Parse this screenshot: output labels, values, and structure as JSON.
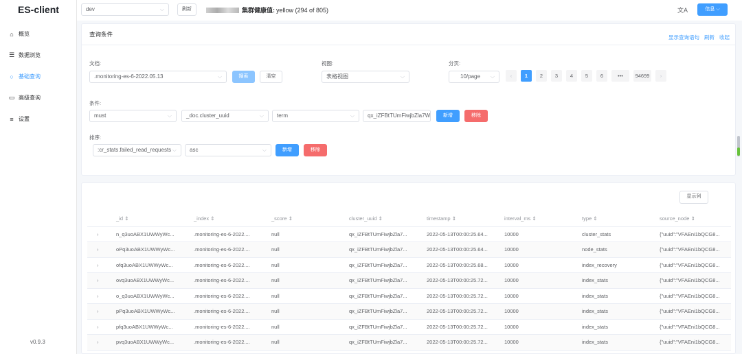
{
  "app": {
    "logo": "ES-client",
    "version": "v0.9.3"
  },
  "sidebar": {
    "items": [
      {
        "label": "概览",
        "icon": "home-icon",
        "active": false
      },
      {
        "label": "数据浏览",
        "icon": "database-icon",
        "active": false
      },
      {
        "label": "基础查询",
        "icon": "search-icon",
        "active": true
      },
      {
        "label": "高级查询",
        "icon": "monitor-icon",
        "active": false
      },
      {
        "label": "设置",
        "icon": "sliders-icon",
        "active": false
      }
    ]
  },
  "header": {
    "cluster_select": "dev",
    "refresh_label": "刷新",
    "health_prefix": "集群健康值:",
    "health_value": "yellow (294 of 805)",
    "lang_icon": "文A",
    "info_label": "信息"
  },
  "query": {
    "title": "查询条件",
    "links": [
      "显示查询语句",
      "刷新",
      "收起"
    ],
    "doc_label": "文档:",
    "doc_value": ".monitoring-es-6-2022.05.13",
    "search_label": "搜索",
    "clear_label": "清空",
    "view_label": "视图:",
    "view_value": "表格视图",
    "page_label": "分页:",
    "page_size": "10/page",
    "pages": [
      "1",
      "2",
      "3",
      "4",
      "5",
      "6",
      "•••",
      "94699"
    ],
    "cond_label": "条件:",
    "cond_bool": "must",
    "cond_field": "_doc.cluster_uuid",
    "cond_op": "term",
    "cond_value": "qx_iZFBtTUmFiwjbZla7WA",
    "add_label": "新增",
    "remove_label": "移除",
    "sort_label": "排序:",
    "sort_field": ":cr_stats.failed_read_requests",
    "sort_order": "asc",
    "sort_add_label": "新增",
    "sort_remove_label": "移除"
  },
  "table": {
    "show_columns_label": "显示列",
    "columns": [
      "_id ⇕",
      "_index ⇕",
      "_score ⇕",
      "cluster_uuid ⇕",
      "timestamp ⇕",
      "interval_ms ⇕",
      "type ⇕",
      "source_node ⇕"
    ],
    "rows": [
      [
        "n_q3uoABX1UWWyWc...",
        ".monitoring-es-6-2022....",
        "null",
        "qx_iZFBtTUmFiwjbZla7...",
        "2022-05-13T00:00:25.64...",
        "10000",
        "cluster_stats",
        "{\"uuid\":\"VFAEni1bQCG8..."
      ],
      [
        "oPq3uoABX1UWWyWc...",
        ".monitoring-es-6-2022....",
        "null",
        "qx_iZFBtTUmFiwjbZla7...",
        "2022-05-13T00:00:25.64...",
        "10000",
        "node_stats",
        "{\"uuid\":\"VFAEni1bQCG8..."
      ],
      [
        "ofq3uoABX1UWWyWc...",
        ".monitoring-es-6-2022....",
        "null",
        "qx_iZFBtTUmFiwjbZla7...",
        "2022-05-13T00:00:25.68...",
        "10000",
        "index_recovery",
        "{\"uuid\":\"VFAEni1bQCG8..."
      ],
      [
        "ovq3uoABX1UWWyWc...",
        ".monitoring-es-6-2022....",
        "null",
        "qx_iZFBtTUmFiwjbZla7...",
        "2022-05-13T00:00:25.72...",
        "10000",
        "index_stats",
        "{\"uuid\":\"VFAEni1bQCG8..."
      ],
      [
        "o_q3uoABX1UWWyWc...",
        ".monitoring-es-6-2022....",
        "null",
        "qx_iZFBtTUmFiwjbZla7...",
        "2022-05-13T00:00:25.72...",
        "10000",
        "index_stats",
        "{\"uuid\":\"VFAEni1bQCG8..."
      ],
      [
        "pPq3uoABX1UWWyWc...",
        ".monitoring-es-6-2022....",
        "null",
        "qx_iZFBtTUmFiwjbZla7...",
        "2022-05-13T00:00:25.72...",
        "10000",
        "index_stats",
        "{\"uuid\":\"VFAEni1bQCG8..."
      ],
      [
        "pfq3uoABX1UWWyWc...",
        ".monitoring-es-6-2022....",
        "null",
        "qx_iZFBtTUmFiwjbZla7...",
        "2022-05-13T00:00:25.72...",
        "10000",
        "index_stats",
        "{\"uuid\":\"VFAEni1bQCG8..."
      ],
      [
        "pvq3uoABX1UWWyWc...",
        ".monitoring-es-6-2022....",
        "null",
        "qx_iZFBtTUmFiwjbZla7...",
        "2022-05-13T00:00:25.72...",
        "10000",
        "index_stats",
        "{\"uuid\":\"VFAEni1bQCG8..."
      ]
    ]
  },
  "colors": {
    "primary": "#409eff",
    "danger": "#f56c6c",
    "sidebar_active": "#409eff"
  }
}
